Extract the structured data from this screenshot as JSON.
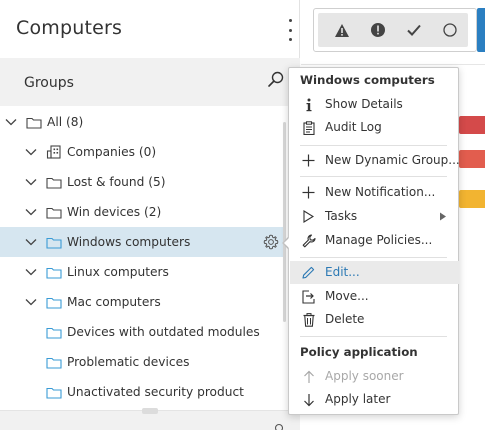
{
  "header": {
    "title": "Computers"
  },
  "groups_panel": {
    "label": "Groups"
  },
  "tree": [
    {
      "label": "All (8)"
    },
    {
      "label": "Companies (0)"
    },
    {
      "label": "Lost & found (5)"
    },
    {
      "label": "Win devices (2)"
    },
    {
      "label": "Windows computers",
      "selected": true
    },
    {
      "label": "Linux computers"
    },
    {
      "label": "Mac computers"
    },
    {
      "label": "Devices with outdated modules"
    },
    {
      "label": "Problematic devices"
    },
    {
      "label": "Unactivated security product"
    }
  ],
  "status_filters": [
    {
      "icon": "warning-triangle-icon"
    },
    {
      "icon": "exclamation-circle-icon"
    },
    {
      "icon": "check-icon"
    },
    {
      "icon": "circle-icon"
    }
  ],
  "colors": {
    "selected_row": "#d6e6f0",
    "accent_blue": "#2b7fc1",
    "link_blue": "#2c79b4",
    "folder_blue": "#3a9bd5",
    "status_red": "#d44a4a",
    "status_yellow": "#f2b431"
  },
  "context_menu": {
    "section_title": "Windows computers",
    "items": {
      "show_details": "Show Details",
      "audit_log": "Audit Log",
      "new_dynamic_group": "New Dynamic Group...",
      "new_notification": "New Notification...",
      "tasks": "Tasks",
      "manage_policies": "Manage Policies...",
      "edit": "Edit...",
      "move": "Move...",
      "delete": "Delete"
    },
    "policy_section_title": "Policy application",
    "policy_items": {
      "apply_sooner": "Apply sooner",
      "apply_later": "Apply later"
    }
  }
}
